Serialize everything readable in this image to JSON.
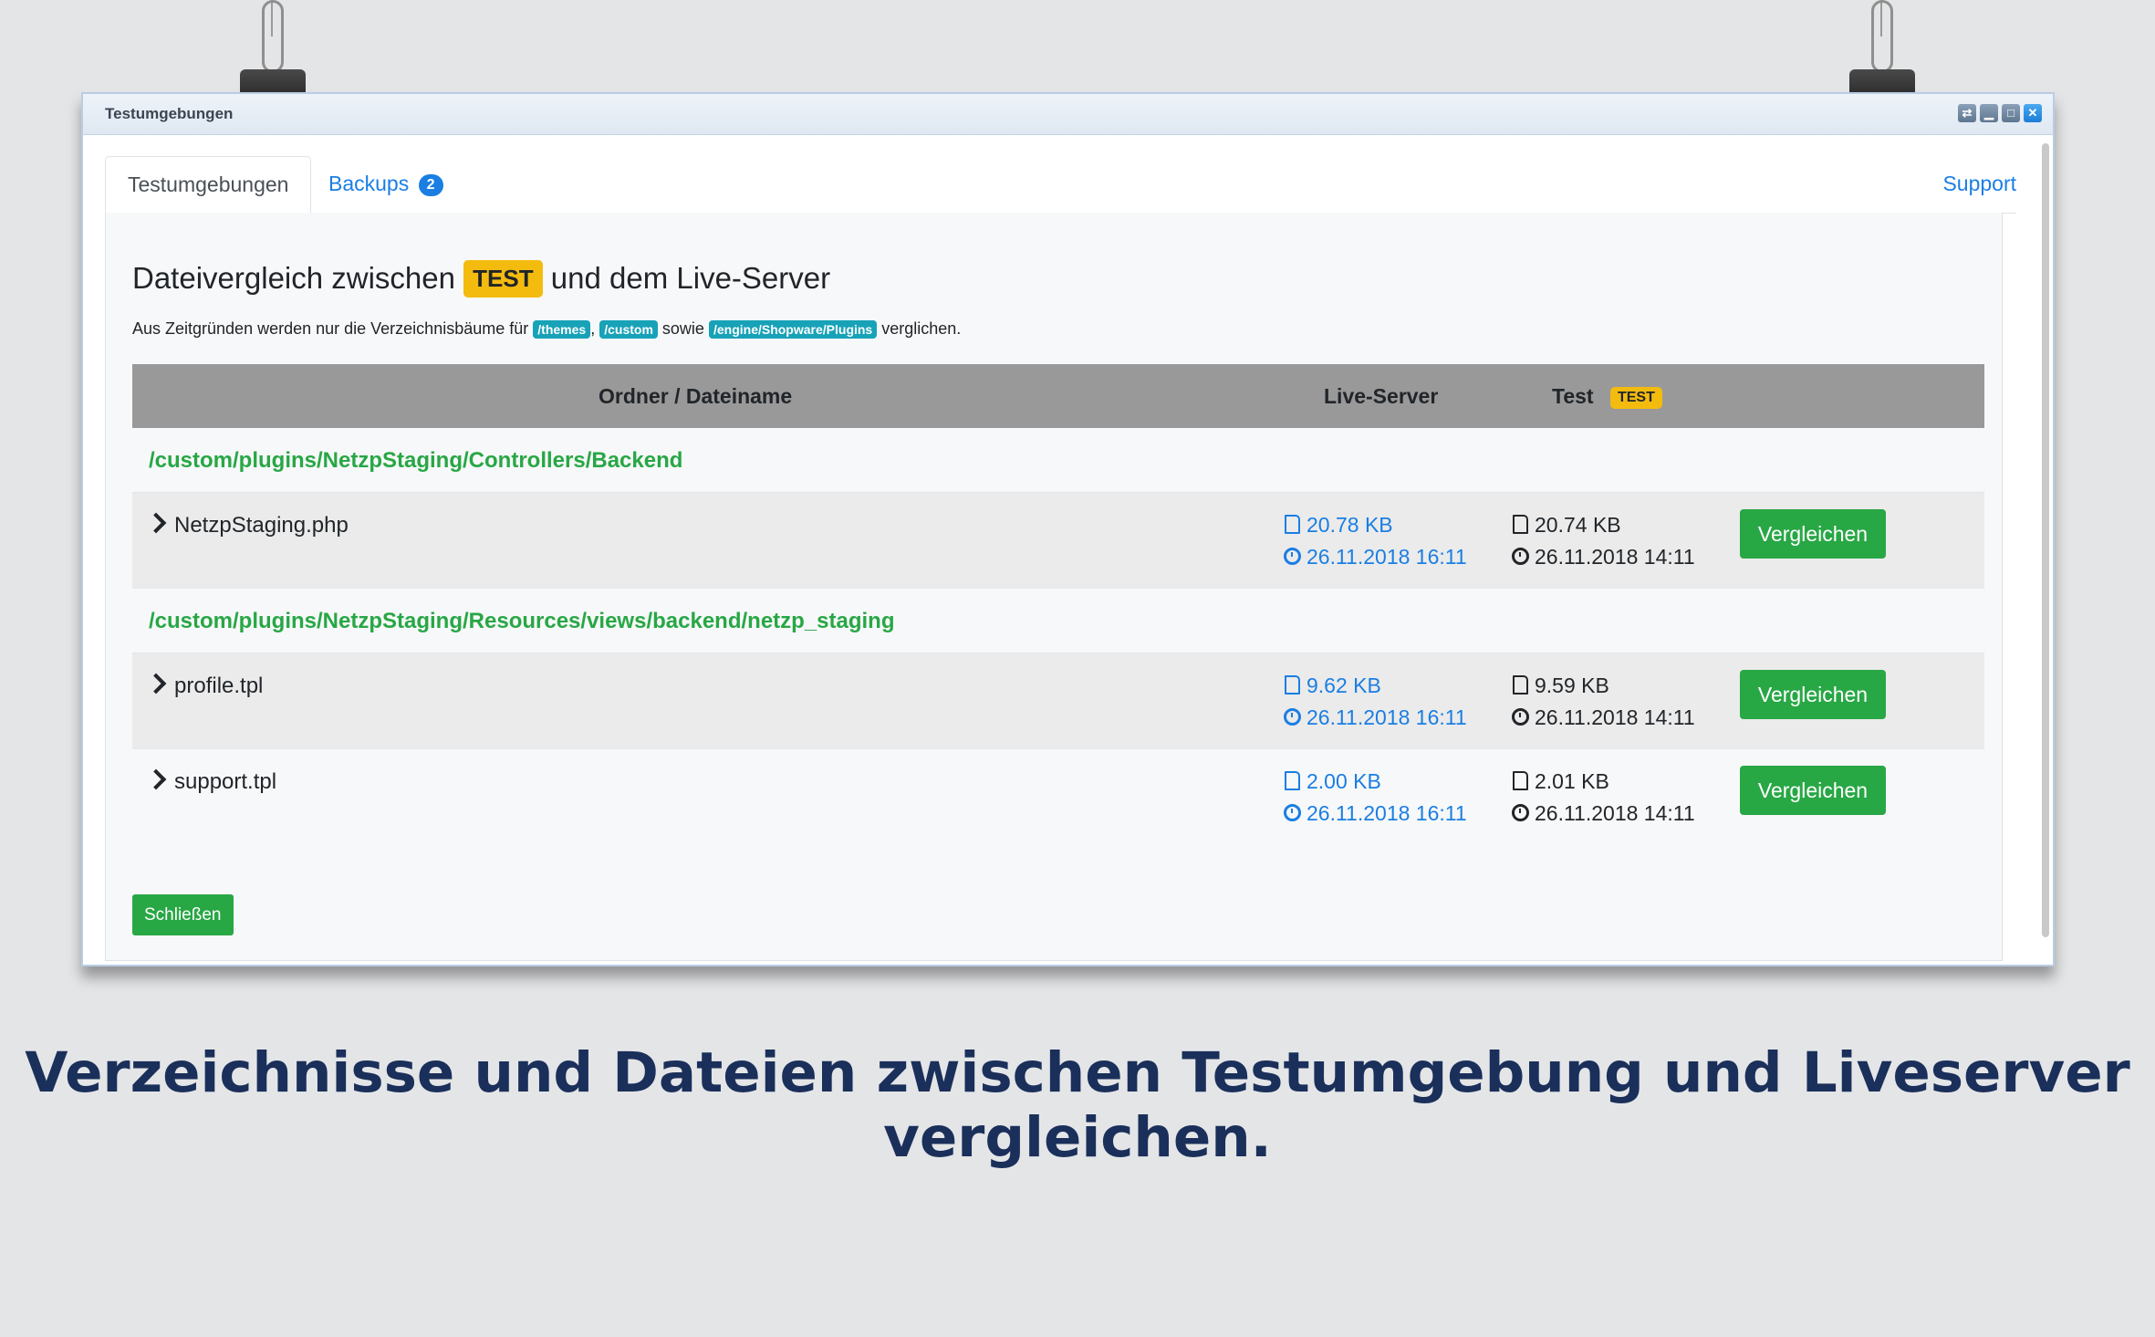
{
  "window": {
    "title": "Testumgebungen"
  },
  "tabs": {
    "testumgebungen": "Testumgebungen",
    "backups": "Backups",
    "backups_count": "2",
    "support": "Support"
  },
  "heading": {
    "prefix": "Dateivergleich zwischen",
    "badge": "TEST",
    "suffix": "und dem Live-Server"
  },
  "note": {
    "prefix": "Aus Zeitgründen werden nur die Verzeichnisbäume für",
    "path1": "/themes",
    "sep": ",",
    "path2": "/custom",
    "mid": "sowie",
    "path3": "/engine/Shopware/Plugins",
    "suffix": "verglichen."
  },
  "table": {
    "headers": {
      "name": "Ordner / Dateiname",
      "live": "Live-Server",
      "test": "Test",
      "test_badge": "TEST"
    },
    "groups": [
      {
        "folder": "/custom/plugins/NetzpStaging/Controllers/Backend",
        "files": [
          {
            "name": "NetzpStaging.php",
            "live_size": "20.78 KB",
            "live_date": "26.11.2018 16:11",
            "test_size": "20.74 KB",
            "test_date": "26.11.2018 14:11",
            "action": "Vergleichen"
          }
        ]
      },
      {
        "folder": "/custom/plugins/NetzpStaging/Resources/views/backend/netzp_staging",
        "files": [
          {
            "name": "profile.tpl",
            "live_size": "9.62 KB",
            "live_date": "26.11.2018 16:11",
            "test_size": "9.59 KB",
            "test_date": "26.11.2018 14:11",
            "action": "Vergleichen"
          },
          {
            "name": "support.tpl",
            "live_size": "2.00 KB",
            "live_date": "26.11.2018 16:11",
            "test_size": "2.01 KB",
            "test_date": "26.11.2018 14:11",
            "action": "Vergleichen"
          }
        ]
      }
    ]
  },
  "close_label": "Schließen",
  "caption": "Verzeichnisse und Dateien zwischen Testumgebung und Liveserver vergleichen.",
  "colors": {
    "accent": "#1a7ee3",
    "success": "#28a745",
    "warning": "#f4bb0f",
    "info": "#17a2b8",
    "caption": "#1a2f5a"
  },
  "icons": [
    "file-icon",
    "clock-icon",
    "chevron-right-icon",
    "binder-clip-icon"
  ]
}
